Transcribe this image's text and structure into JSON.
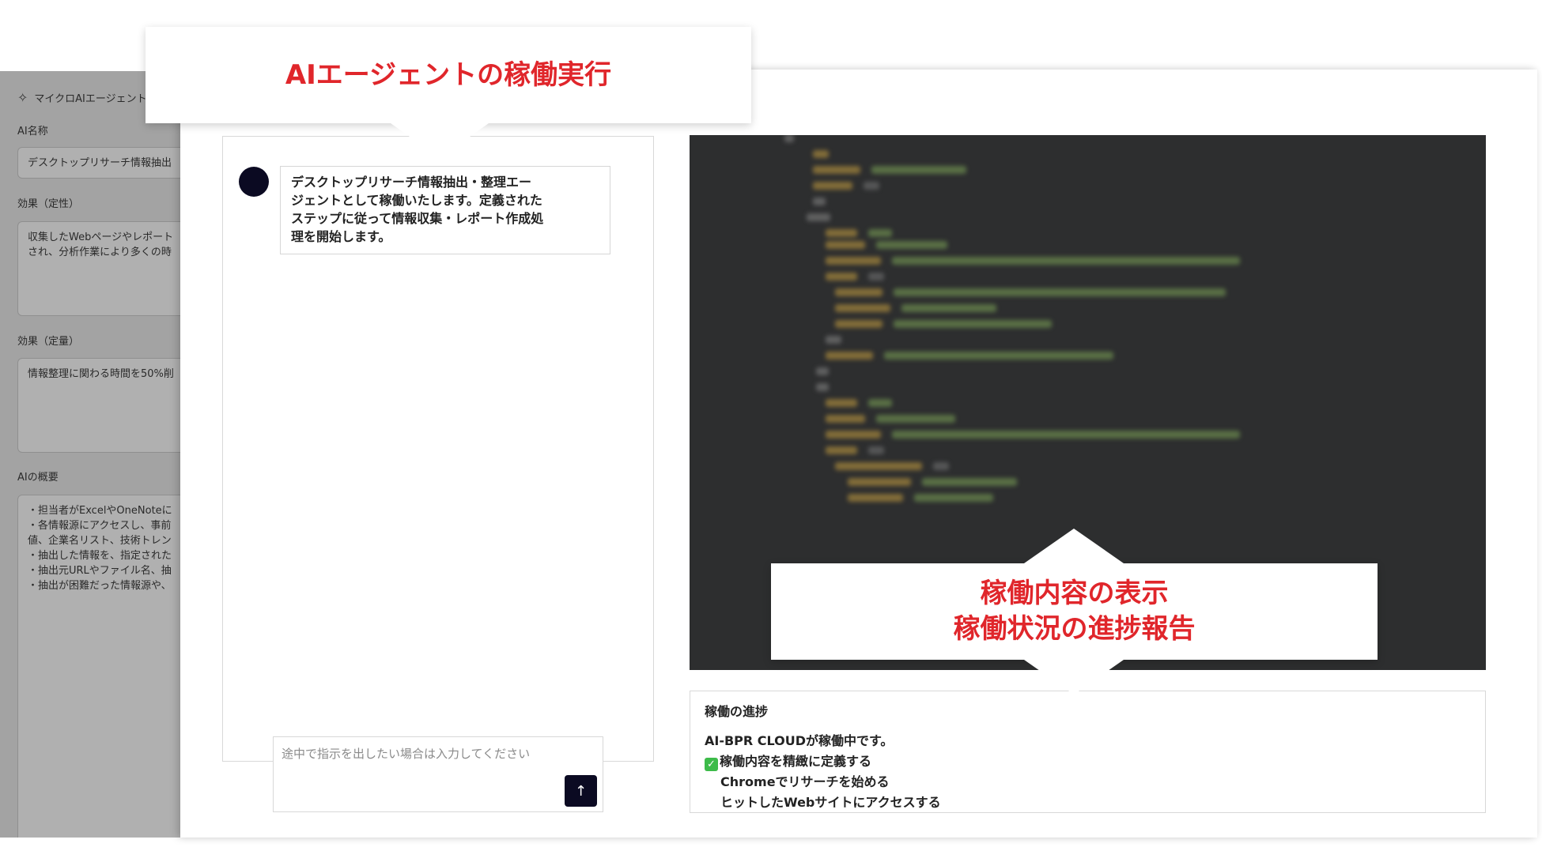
{
  "left_panel": {
    "title": "マイクロAIエージェント",
    "ai_name_label": "AI名称",
    "ai_name_value": "デスクトップリサーチ情報抽出",
    "qualitative_label": "効果（定性）",
    "qualitative_lines": [
      "収集したWebページやレポート",
      "され、分析作業により多くの時"
    ],
    "quantitative_label": "効果（定量）",
    "quantitative_value": "情報整理に関わる時間を50%削",
    "overview_label": "AIの概要",
    "overview_lines": [
      "・担当者がExcelやOneNoteに",
      "・各情報源にアクセスし、事前",
      "値、企業名リスト、技術トレン",
      "・抽出した情報を、指定された",
      "・抽出元URLやファイル名、抽",
      "・抽出が困難だった情報源や、"
    ]
  },
  "callouts": {
    "top": "AIエージェントの稼働実行",
    "right_line1": "稼働内容の表示",
    "right_line2": "稼働状況の進捗報告"
  },
  "chat": {
    "message_lines": [
      "デスクトップリサーチ情報抽出・整理エー",
      "ジェントとして稼働いたします。定義された",
      "ステップに従って情報収集・レポート作成処",
      "理を開始します。"
    ],
    "input_placeholder": "途中で指示を出したい場合は入力してください",
    "send_icon": "↑"
  },
  "progress": {
    "title": "稼働の進捗",
    "line1": "AI-BPR CLOUDが稼働中です。",
    "line2": "稼働内容を精緻に定義する",
    "line3": "Chromeでリサーチを始める",
    "line4": "ヒットしたWebサイトにアクセスする"
  },
  "colors": {
    "callout_text": "#e0262b",
    "terminal_bg": "#2d2e2f",
    "accent_dark": "#0b0a22",
    "check_green": "#3dbb4a"
  }
}
